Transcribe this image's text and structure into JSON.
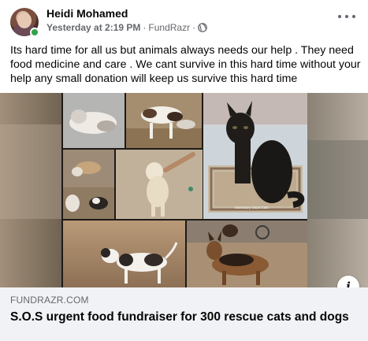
{
  "post": {
    "author": "Heidi Mohamed",
    "timestamp": "Yesterday at 2:19 PM",
    "separator": "·",
    "via": "FundRazr",
    "separator_2": "·",
    "privacy_icon": "globe-icon",
    "more_icon": "more-horizontal-icon",
    "text": "Its hard time for all us but animals always needs our help . They need food medicine and care . We cant survive in this hard time without your help any small donation will keep us survive this hard time"
  },
  "avatar": {
    "online_status_color": "#31a24c"
  },
  "media": {
    "watermark": "Sanctuary Gaza Cats",
    "info_icon": "info-icon"
  },
  "link": {
    "domain": "FUNDRAZR.COM",
    "title": "S.O.S urgent food fundraiser for 300 rescue cats and dogs"
  }
}
